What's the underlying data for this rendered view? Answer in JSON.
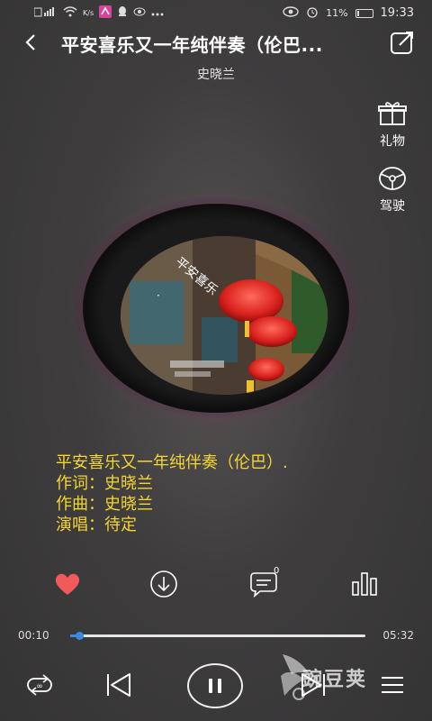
{
  "status_bar": {
    "network_speed": "K/s",
    "battery_pct": 11,
    "battery_text": "11%",
    "time": "19:33"
  },
  "header": {
    "title": "平安喜乐又一年纯伴奏（伦巴...",
    "artist": "史晓兰"
  },
  "side_actions": [
    {
      "icon": "gift-icon",
      "label": "礼物"
    },
    {
      "icon": "steering-wheel-icon",
      "label": "驾驶"
    }
  ],
  "lyrics": {
    "line1": "平安喜乐又一年纯伴奏（伦巴）.",
    "line2": "作词：史晓兰",
    "line3": "作曲：史晓兰",
    "line4": "演唱：待定"
  },
  "action_row": [
    {
      "icon": "heart-icon",
      "state": "liked",
      "color": "#f05a5a"
    },
    {
      "icon": "download-icon"
    },
    {
      "icon": "comment-icon",
      "badge": "0"
    },
    {
      "icon": "equalizer-icon"
    }
  ],
  "progress": {
    "current": "00:10",
    "total": "05:32",
    "fraction": 0.03,
    "accent": "#3a8be0"
  },
  "controls": [
    {
      "icon": "repeat-icon"
    },
    {
      "icon": "previous-icon"
    },
    {
      "icon": "pause-icon"
    },
    {
      "icon": "next-icon"
    },
    {
      "icon": "playlist-icon"
    }
  ],
  "watermark": {
    "text": "豌豆荚"
  },
  "colors": {
    "lyric_text": "#f5d630",
    "background": "#3f3d3e"
  }
}
